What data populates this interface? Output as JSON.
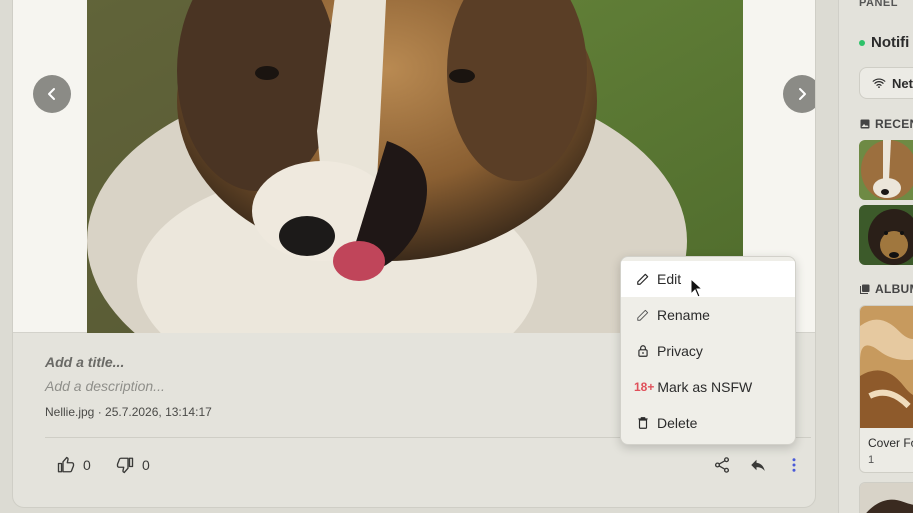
{
  "post": {
    "title_placeholder": "Add a title...",
    "description_placeholder": "Add a description...",
    "meta": "Nellie.jpg · 25.7.2026, 13:14:17",
    "upvotes": "0",
    "downvotes": "0",
    "image_icon": "collie-dog-photo"
  },
  "menu": {
    "items": [
      {
        "label": "Edit",
        "icon": "pencil-icon"
      },
      {
        "label": "Rename",
        "icon": "pencil-outline-icon"
      },
      {
        "label": "Privacy",
        "icon": "lock-icon"
      },
      {
        "label": "Mark as NSFW",
        "icon": "18+",
        "badge": "18+"
      },
      {
        "label": "Delete",
        "icon": "trash-icon"
      }
    ]
  },
  "panel": {
    "header": "PANEL",
    "notifications_label": "Notifi",
    "network_label": "Net",
    "recent_label": "RECEN",
    "albums_label": "ALBUM",
    "album": {
      "name": "Cover Fo",
      "count": "1"
    }
  },
  "colors": {
    "accent": "#4a5ad8",
    "online": "#2ec26a",
    "nsfw": "#e0505a"
  }
}
